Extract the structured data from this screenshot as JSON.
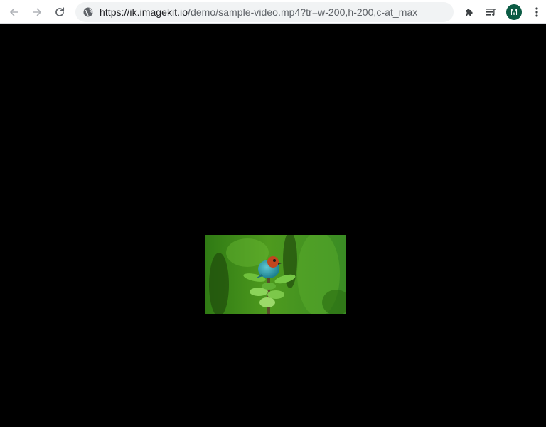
{
  "browser": {
    "url_host": "https://ik.imagekit.io",
    "url_path": "/demo/sample-video.mp4?tr=w-200,h-200,c-at_max",
    "profile_initial": "M",
    "icons": {
      "back": "arrow-left-icon",
      "forward": "arrow-right-icon",
      "reload": "reload-icon",
      "site_info": "globe-icon",
      "extensions": "puzzle-piece-icon",
      "media": "media-control-icon",
      "menu": "three-dot-menu-icon"
    },
    "colors": {
      "toolbar_bg": "#ffffff",
      "omnibox_bg": "#f1f3f4",
      "avatar_bg": "#0b5b44",
      "page_bg": "#000000"
    }
  },
  "video": {
    "subject": "bird perched on plant stem",
    "colors": {
      "background": "#3a8a1e",
      "bird_body": "#2aa6b8",
      "bird_head": "#b8401e"
    }
  }
}
